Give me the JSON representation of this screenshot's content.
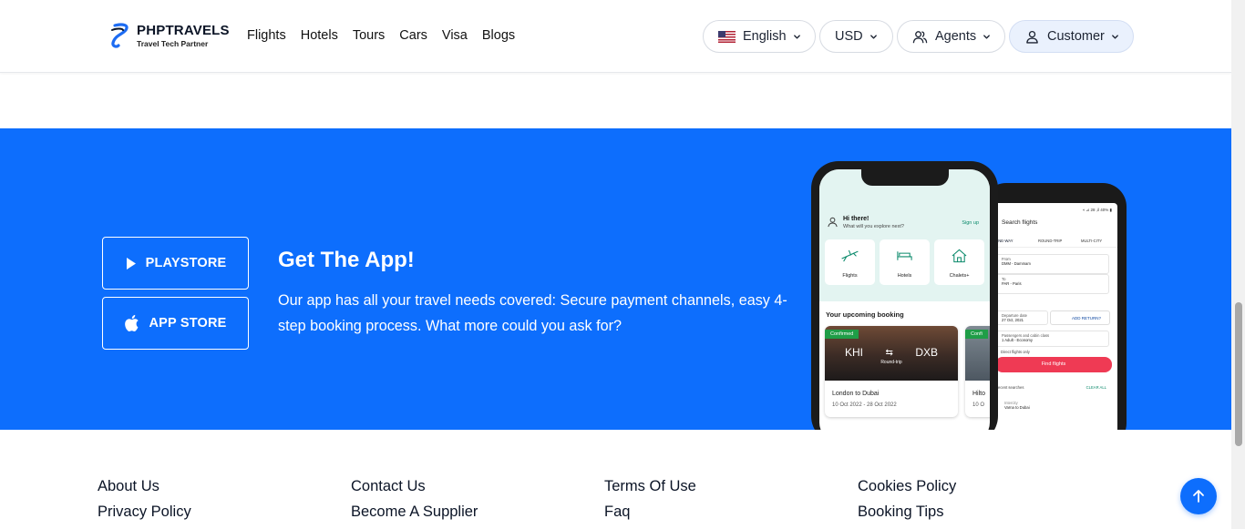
{
  "brand": {
    "name": "PHPTRAVELS",
    "tagline": "Travel Tech Partner"
  },
  "nav": [
    "Flights",
    "Hotels",
    "Tours",
    "Cars",
    "Visa",
    "Blogs"
  ],
  "header_controls": {
    "language": "English",
    "currency": "USD",
    "agents": "Agents",
    "customer": "Customer"
  },
  "app_section": {
    "playstore_label": "PLAYSTORE",
    "appstore_label": "APP STORE",
    "title": "Get The App!",
    "description": "Our app has all your travel needs covered: Secure payment channels, easy 4-step booking process. What more could you ask for?"
  },
  "phone_front": {
    "greeting": "Hi there!",
    "greeting_sub": "What will you explore next?",
    "signup": "Sign up",
    "categories": [
      "Flights",
      "Hotels",
      "Chalets+"
    ],
    "upcoming_title": "Your upcoming booking",
    "card1": {
      "status": "Confirmed",
      "from": "KHI",
      "to": "DXB",
      "trip": "Round-trip",
      "route": "London to Dubai",
      "dates": "10 Oct 2022 - 28 Oct 2022"
    },
    "card2": {
      "status": "Confi",
      "route": "Hilto",
      "dates": "10 O"
    }
  },
  "phone_back": {
    "status": "◖ ⊿ 28 ,il 40% ▮",
    "title": "Search flights",
    "tabs": [
      "ONE-WAY",
      "ROUND-TRIP",
      "MULTI-CITY"
    ],
    "from_label": "From",
    "from_value": "DMM - Dammam",
    "to_label": "To",
    "to_value": "PAR - Paris",
    "depart_label": "Departure date",
    "depart_value": "27 Oct, 2021",
    "return_label": "ADD RETURN?",
    "pax_label": "Passengers and cabin class",
    "pax_value": "1 Adult - Economy",
    "direct_label": "Direct flights only",
    "find_label": "Find flights",
    "recent_label": "Recent searches",
    "clear_label": "CLEAR ALL",
    "recent_item_label": "Intercity",
    "recent_item": "Varna to Dubai"
  },
  "footer_links": {
    "col1": [
      "About Us",
      "Privacy Policy"
    ],
    "col2": [
      "Contact Us",
      "Become A Supplier"
    ],
    "col3": [
      "Terms Of Use",
      "Faq"
    ],
    "col4": [
      "Cookies Policy",
      "Booking Tips"
    ]
  },
  "colors": {
    "primary": "#0d6efd",
    "header_bg": "#ffffff",
    "customer_pill_bg": "#eaf1fd"
  }
}
